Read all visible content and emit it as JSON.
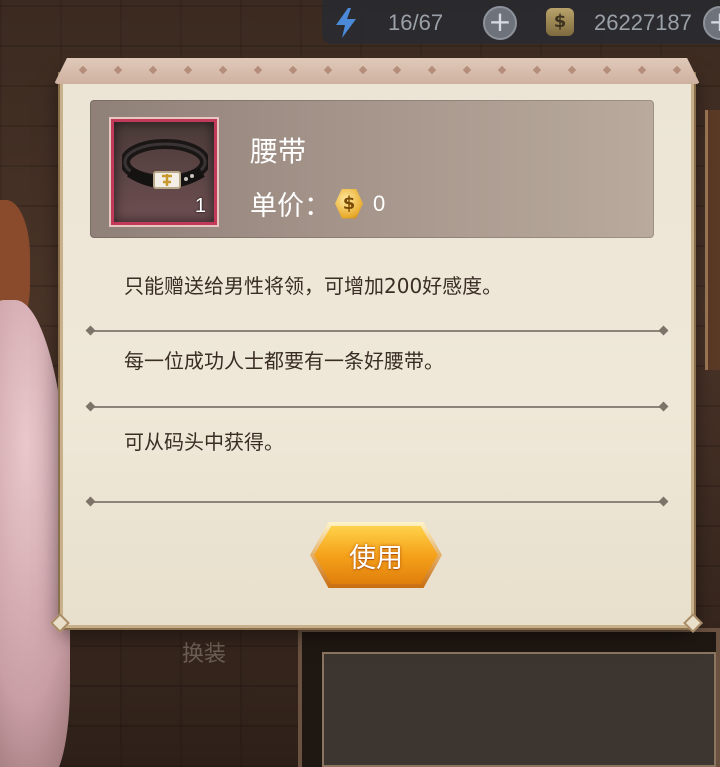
{
  "topbar": {
    "energy": "16/67",
    "money": "26227187",
    "energy_icon": "lightning-icon",
    "money_icon": "dollar-coin-icon",
    "plus_symbol": "+"
  },
  "background": {
    "caption": "换装"
  },
  "item": {
    "name": "腰带",
    "count": "1",
    "price_label": "单价：",
    "price_icon": "gold-coin-icon",
    "coin_symbol": "$",
    "price_value": "0",
    "icon": "belt-icon"
  },
  "descriptions": {
    "effect": "只能赠送给男性将领，可增加200好感度。",
    "flavor": "每一位成功人士都要有一条好腰带。",
    "source": "可从码头中获得。"
  },
  "actions": {
    "use_label": "使用"
  },
  "colors": {
    "dialog_bg": "#efe8d8",
    "header_bg": "#a39288",
    "slot_border": "#c23a5a",
    "button_orange": "#f5a21b",
    "text_dark": "#3a2e24"
  }
}
